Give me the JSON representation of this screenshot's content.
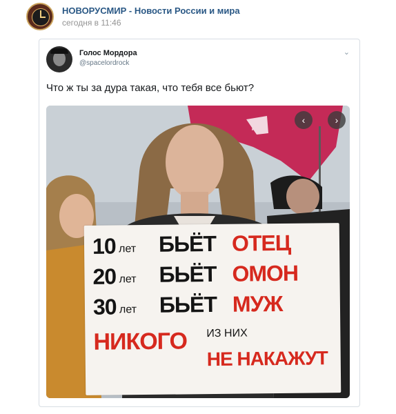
{
  "post": {
    "group_name": "НОВОРУСМИР - Новости России и мира",
    "time": "сегодня в 11:46"
  },
  "tweet": {
    "author_name": "Голос Мордора",
    "author_handle": "@spacelordrock",
    "text": "Что ж ты за дура такая, что тебя все бьют?"
  },
  "photo": {
    "sign": {
      "line1": {
        "num": "10",
        "unit": "лет",
        "verb": "БЬЁТ",
        "who": "ОТЕЦ"
      },
      "line2": {
        "num": "20",
        "unit": "лет",
        "verb": "БЬЁТ",
        "who": "ОМОН"
      },
      "line3": {
        "num": "30",
        "unit": "лет",
        "verb": "БЬЁТ",
        "who": "МУЖ"
      },
      "bottom_main": "НИКОГО",
      "bottom_small": "ИЗ НИХ",
      "bottom_end": "НЕ НАКАЖУТ"
    },
    "nav": {
      "prev": "‹",
      "next": "›"
    }
  },
  "icons": {
    "avatar": "clock-logo-icon",
    "menu": "chevron-down-icon"
  },
  "colors": {
    "link": "#2a5885",
    "sign_red": "#d6291e",
    "flag": "#c42a57"
  }
}
